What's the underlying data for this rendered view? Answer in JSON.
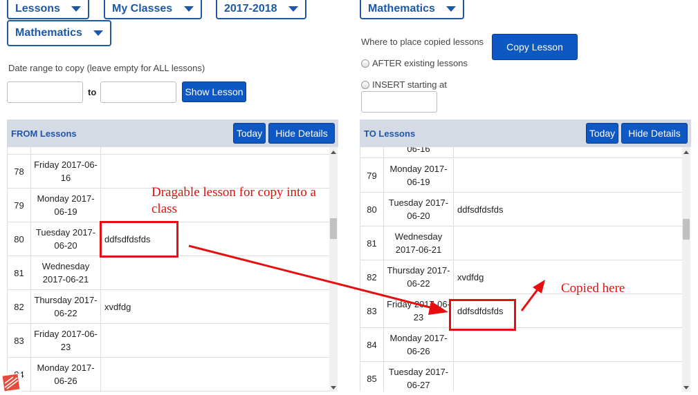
{
  "left": {
    "dropdowns": {
      "lessons": "Lessons",
      "classes": "My Classes",
      "year": "2017-2018",
      "subject": "Mathematics"
    },
    "date_range_label": "Date range to copy (leave empty for ALL lessons)",
    "to_label": "to",
    "show_lesson_button": "Show Lesson",
    "panel_title": "FROM Lessons",
    "today_button": "Today",
    "hide_details_button": "Hide Details",
    "rows": [
      {
        "num": "78",
        "date": "Friday 2017-06-16",
        "lesson": ""
      },
      {
        "num": "79",
        "date": "Monday 2017-06-19",
        "lesson": ""
      },
      {
        "num": "80",
        "date": "Tuesday 2017-06-20",
        "lesson": "ddfsdfdsfds"
      },
      {
        "num": "81",
        "date": "Wednesday 2017-06-21",
        "lesson": ""
      },
      {
        "num": "82",
        "date": "Thursday 2017-06-22",
        "lesson": "xvdfdg"
      },
      {
        "num": "83",
        "date": "Friday 2017-06-23",
        "lesson": ""
      },
      {
        "num": "84",
        "date": "Monday 2017-06-26",
        "lesson": ""
      }
    ]
  },
  "right": {
    "subject_dropdown": "Mathematics",
    "place_label": "Where to place copied lessons",
    "copy_button": "Copy Lesson",
    "radio_after": "AFTER existing lessons",
    "radio_insert": "INSERT starting at",
    "panel_title": "TO Lessons",
    "today_button": "Today",
    "hide_details_button": "Hide Details",
    "rows": [
      {
        "num": "",
        "date": "06-16",
        "lesson": ""
      },
      {
        "num": "79",
        "date": "Monday 2017-06-19",
        "lesson": ""
      },
      {
        "num": "80",
        "date": "Tuesday 2017-06-20",
        "lesson": "ddfsdfdsfds"
      },
      {
        "num": "81",
        "date": "Wednesday 2017-06-21",
        "lesson": ""
      },
      {
        "num": "82",
        "date": "Thursday 2017-06-22",
        "lesson": "xvdfdg"
      },
      {
        "num": "83",
        "date": "Friday 2017-06-23",
        "lesson": "ddfsdfdsfds"
      },
      {
        "num": "84",
        "date": "Monday 2017-06-26",
        "lesson": ""
      },
      {
        "num": "85",
        "date": "Tuesday 2017-06-27",
        "lesson": ""
      }
    ]
  },
  "annotations": {
    "drag_note": "Dragable lesson for copy into a class",
    "copied_note": "Copied here"
  },
  "colors": {
    "accent": "#1d57a8",
    "button": "#0d58c2",
    "annotation": "#e60f0f"
  }
}
